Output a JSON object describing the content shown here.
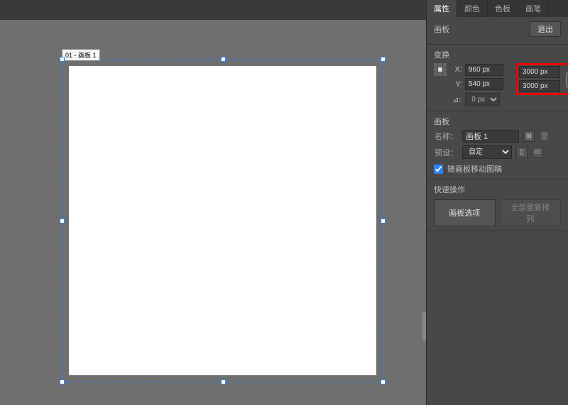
{
  "topbar": {},
  "canvas": {
    "artboard_label": "01 - 画板 1"
  },
  "panel": {
    "tabs": {
      "t1": "属性",
      "t2": "颜色",
      "t3": "色板",
      "t4": "画笔"
    },
    "sec_artboard": {
      "title": "画板",
      "exit_btn": "退出"
    },
    "sec_xform": {
      "title": "变换",
      "x_lbl": "X:",
      "x_val": "960 px",
      "y_lbl": "Y:",
      "y_val": "540 px",
      "w_val": "3000 px",
      "h_val": "3000 px",
      "ang_lbl": "⊿:",
      "ang_val": "0 px"
    },
    "sec_ab2": {
      "title": "画板",
      "name_lbl": "名称：",
      "name_val": "画板 1",
      "preset_lbl": "预设：",
      "preset_val": "自定",
      "move_chk": "随画板移动图稿"
    },
    "sec_quick": {
      "title": "快速操作",
      "opt_btn": "画板选项",
      "rearr_btn": "全部重新排列"
    }
  }
}
